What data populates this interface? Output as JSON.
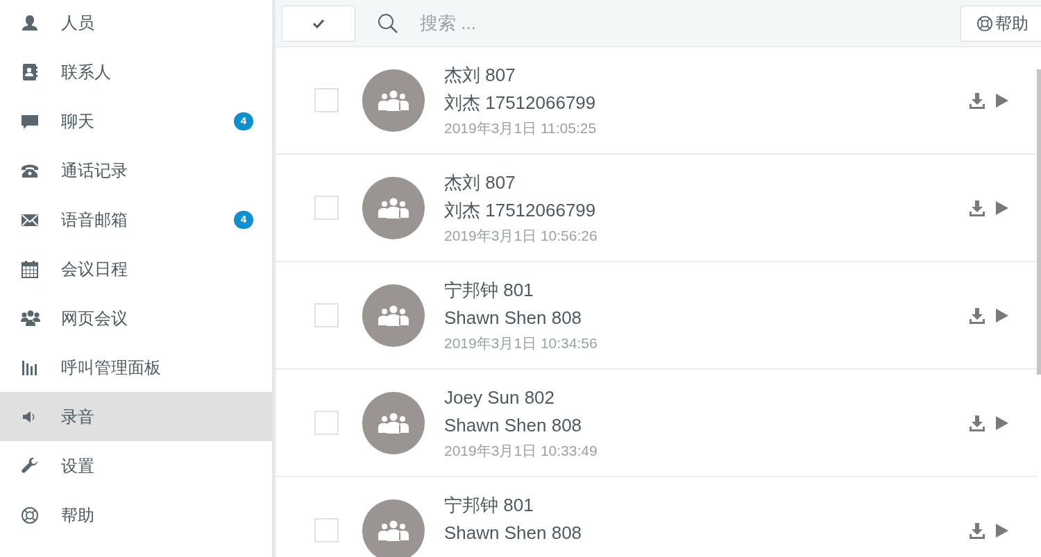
{
  "sidebar": {
    "items": [
      {
        "label": "人员",
        "selected": false
      },
      {
        "label": "联系人",
        "selected": false
      },
      {
        "label": "聊天",
        "selected": false,
        "badge": "4"
      },
      {
        "label": "通话记录",
        "selected": false
      },
      {
        "label": "语音邮箱",
        "selected": false,
        "badge": "4"
      },
      {
        "label": "会议日程",
        "selected": false
      },
      {
        "label": "网页会议",
        "selected": false
      },
      {
        "label": "呼叫管理面板",
        "selected": false
      },
      {
        "label": "录音",
        "selected": true
      },
      {
        "label": "设置",
        "selected": false
      },
      {
        "label": "帮助",
        "selected": false
      }
    ]
  },
  "toolbar": {
    "search": {
      "placeholder": "搜索 ..."
    },
    "help_button": "帮助"
  },
  "recordings": [
    {
      "line_1": "杰刘 807",
      "line_2": "刘杰 17512066799",
      "time": "2019年3月1日 11:05:25",
      "checked": false
    },
    {
      "line_1": "杰刘 807",
      "line_2": "刘杰 17512066799",
      "time": "2019年3月1日 10:56:26",
      "checked": false
    },
    {
      "line_1": "宁邦钟 801",
      "line_2": "Shawn Shen 808",
      "time": "2019年3月1日 10:34:56",
      "checked": false
    },
    {
      "line_1": "Joey Sun 802",
      "line_2": "Shawn Shen 808",
      "time": "2019年3月1日 10:33:49",
      "checked": false
    },
    {
      "line_1": "宁邦钟 801",
      "line_2": "Shawn Shen 808",
      "checked": false
    }
  ]
}
